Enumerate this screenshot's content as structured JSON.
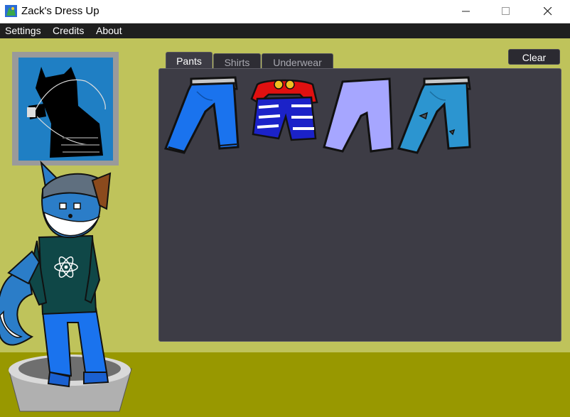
{
  "window": {
    "title": "Zack's Dress Up",
    "controls": [
      "minimize-icon",
      "maximize-icon",
      "close-icon"
    ]
  },
  "menu": {
    "items": [
      {
        "label": "Settings"
      },
      {
        "label": "Credits"
      },
      {
        "label": "About"
      }
    ]
  },
  "tabs": [
    {
      "label": "Pants",
      "active": true
    },
    {
      "label": "Shirts",
      "active": false
    },
    {
      "label": "Underwear",
      "active": false
    }
  ],
  "clear_label": "Clear",
  "wardrobe": {
    "items": [
      {
        "icon": "blue-jeans-icon",
        "color": "#1a73ee"
      },
      {
        "icon": "striped-shorts-icon",
        "color": "#1b22c8"
      },
      {
        "icon": "lavender-pants-icon",
        "color": "#a6a6ff"
      },
      {
        "icon": "ripped-jeans-icon",
        "color": "#2c95d0"
      }
    ]
  },
  "colors": {
    "wall": "#bfc35b",
    "floor": "#989800",
    "panel": "#3d3c45",
    "menubar": "#1f1f1f"
  }
}
